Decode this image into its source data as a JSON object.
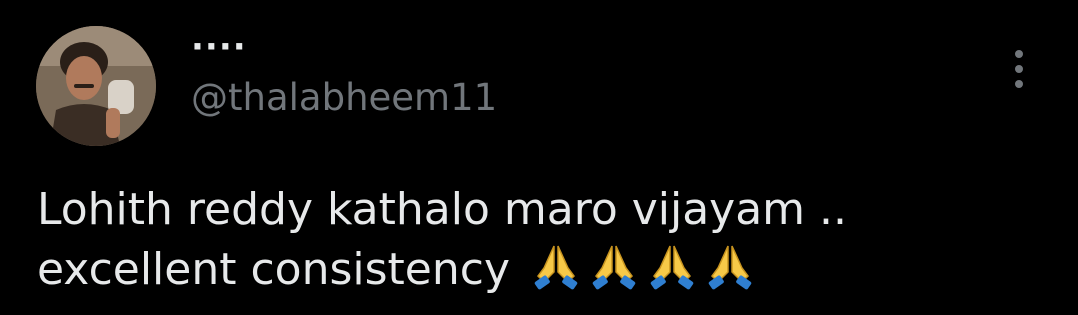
{
  "author": {
    "display_name": "····",
    "handle": "@thalabheem11",
    "avatar_alt": "profile photo"
  },
  "tweet": {
    "line1": "Lohith reddy kathalo maro vijayam ..",
    "line2": "excellent consistency",
    "emoji": [
      "folded-hands",
      "folded-hands",
      "folded-hands",
      "folded-hands"
    ]
  },
  "colors": {
    "background": "#000000",
    "primary_text": "#e7e9ea",
    "secondary_text": "#71767b"
  }
}
